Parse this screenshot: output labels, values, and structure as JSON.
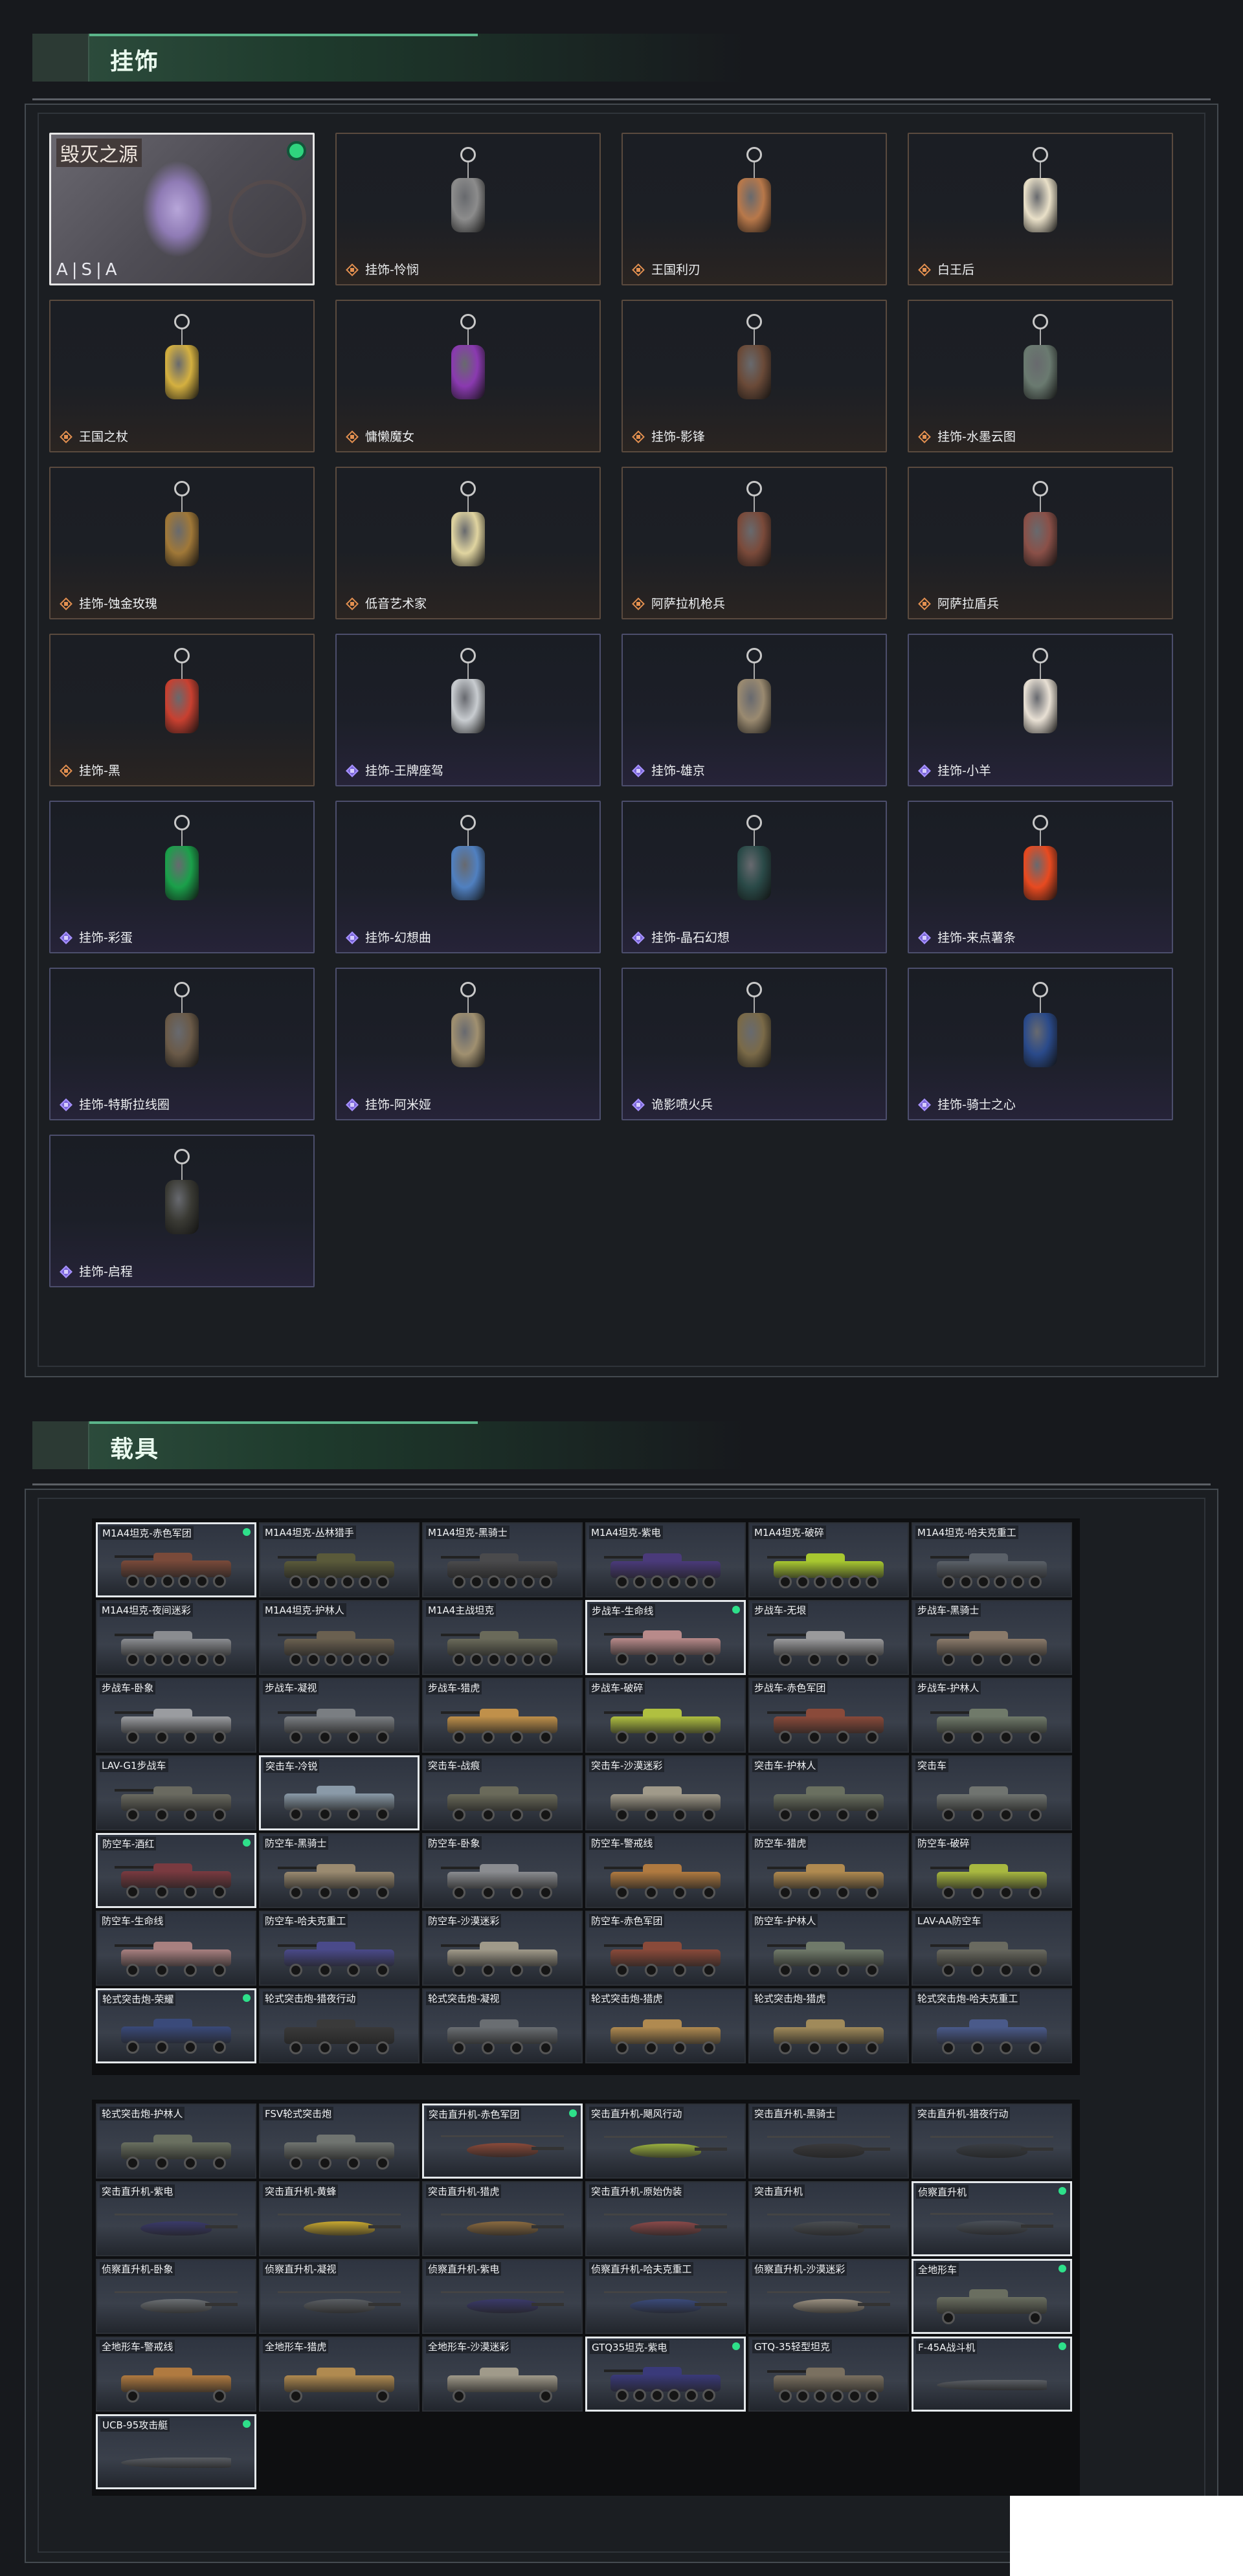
{
  "pendants": {
    "title": "挂饰",
    "featured": {
      "title": "毁灭之源",
      "logo": "A|S|A"
    },
    "items": [
      {
        "label": "挂饰-怜悯",
        "rarity": "orange",
        "color": "#8c8c8c"
      },
      {
        "label": "王国利刃",
        "rarity": "orange",
        "color": "#b8784a"
      },
      {
        "label": "白王后",
        "rarity": "orange",
        "color": "#e9e0c8"
      },
      {
        "label": "王国之杖",
        "rarity": "orange",
        "color": "#d4b040"
      },
      {
        "label": "慵懒魔女",
        "rarity": "orange",
        "color": "#8a3ab0"
      },
      {
        "label": "挂饰-影锋",
        "rarity": "orange",
        "color": "#6a4a38"
      },
      {
        "label": "挂饰-水墨云图",
        "rarity": "orange",
        "color": "#6a7a70"
      },
      {
        "label": "挂饰-蚀金玫瑰",
        "rarity": "orange",
        "color": "#a07838"
      },
      {
        "label": "低音艺术家",
        "rarity": "orange",
        "color": "#e0d4a0"
      },
      {
        "label": "阿萨拉机枪兵",
        "rarity": "orange",
        "color": "#7a4a3a"
      },
      {
        "label": "阿萨拉盾兵",
        "rarity": "orange",
        "color": "#8a5048"
      },
      {
        "label": "挂饰-黑",
        "rarity": "orange",
        "color": "#c84030"
      },
      {
        "label": "挂饰-王牌座驾",
        "rarity": "purple",
        "color": "#c8ccd0"
      },
      {
        "label": "挂饰-雄京",
        "rarity": "purple",
        "color": "#9a8a70"
      },
      {
        "label": "挂饰-小羊",
        "rarity": "purple",
        "color": "#e8e0d4"
      },
      {
        "label": "挂饰-彩蛋",
        "rarity": "purple",
        "color": "#1aa04a"
      },
      {
        "label": "挂饰-幻想曲",
        "rarity": "purple",
        "color": "#5080c0"
      },
      {
        "label": "挂饰-晶石幻想",
        "rarity": "purple",
        "color": "#2a4a48"
      },
      {
        "label": "挂饰-来点薯条",
        "rarity": "purple",
        "color": "#e84a20"
      },
      {
        "label": "挂饰-特斯拉线圈",
        "rarity": "purple",
        "color": "#6a5a48"
      },
      {
        "label": "挂饰-阿米娅",
        "rarity": "purple",
        "color": "#a09070"
      },
      {
        "label": "诡影喷火兵",
        "rarity": "purple",
        "color": "#7a6a48"
      },
      {
        "label": "挂饰-骑士之心",
        "rarity": "purple",
        "color": "#2a4a8a"
      },
      {
        "label": "挂饰-启程",
        "rarity": "purple",
        "color": "#3a3a34"
      }
    ]
  },
  "vehicles": {
    "title": "载具",
    "group1": [
      {
        "label": "M1A4坦克-赤色军团",
        "owned": true,
        "selected": true,
        "type": "tank",
        "color": "#7a4a3a"
      },
      {
        "label": "M1A4坦克-丛林猎手",
        "owned": false,
        "selected": false,
        "type": "tank",
        "color": "#5a5a3a"
      },
      {
        "label": "M1A4坦克-黑骑士",
        "owned": false,
        "selected": false,
        "type": "tank",
        "color": "#4a4a4c"
      },
      {
        "label": "M1A4坦克-紫电",
        "owned": false,
        "selected": false,
        "type": "tank",
        "color": "#4a3a7a"
      },
      {
        "label": "M1A4坦克-破碎",
        "owned": false,
        "selected": false,
        "type": "tank",
        "color": "#a8c830"
      },
      {
        "label": "M1A4坦克-哈夫克重工",
        "owned": false,
        "selected": false,
        "type": "tank",
        "color": "#5a6068"
      },
      {
        "label": "M1A4坦克-夜间迷彩",
        "owned": false,
        "selected": false,
        "type": "tank",
        "color": "#8a8c90"
      },
      {
        "label": "M1A4坦克-护林人",
        "owned": false,
        "selected": false,
        "type": "tank",
        "color": "#6a6050"
      },
      {
        "label": "M1A4主战坦克",
        "owned": false,
        "selected": false,
        "type": "tank",
        "color": "#6a6a5a"
      },
      {
        "label": "步战车-生命线",
        "owned": true,
        "selected": true,
        "type": "ifv",
        "color": "#b88a8a"
      },
      {
        "label": "步战车-无垠",
        "owned": false,
        "selected": false,
        "type": "ifv",
        "color": "#9a9a9c"
      },
      {
        "label": "步战车-黑骑士",
        "owned": false,
        "selected": false,
        "type": "ifv",
        "color": "#8a7a6a"
      },
      {
        "label": "步战车-卧象",
        "owned": false,
        "selected": false,
        "type": "ifv",
        "color": "#9a9ca0"
      },
      {
        "label": "步战车-凝视",
        "owned": false,
        "selected": false,
        "type": "ifv",
        "color": "#7a7e82"
      },
      {
        "label": "步战车-猎虎",
        "owned": false,
        "selected": false,
        "type": "ifv",
        "color": "#c0904a"
      },
      {
        "label": "步战车-破碎",
        "owned": false,
        "selected": false,
        "type": "ifv",
        "color": "#b0c040"
      },
      {
        "label": "步战车-赤色军团",
        "owned": false,
        "selected": false,
        "type": "ifv",
        "color": "#8a4a3a"
      },
      {
        "label": "步战车-护林人",
        "owned": false,
        "selected": false,
        "type": "ifv",
        "color": "#707a6a"
      },
      {
        "label": "LAV-G1步战车",
        "owned": false,
        "selected": false,
        "type": "ifv",
        "color": "#6a6a60"
      },
      {
        "label": "突击车-冷锐",
        "owned": false,
        "selected": true,
        "type": "truck",
        "color": "#8a9aa8"
      },
      {
        "label": "突击车-战痕",
        "owned": false,
        "selected": false,
        "type": "truck",
        "color": "#6a6a5a"
      },
      {
        "label": "突击车-沙漠迷彩",
        "owned": false,
        "selected": false,
        "type": "truck",
        "color": "#a09a8a"
      },
      {
        "label": "突击车-护林人",
        "owned": false,
        "selected": false,
        "type": "truck",
        "color": "#6a7060"
      },
      {
        "label": "突击车",
        "owned": false,
        "selected": false,
        "type": "truck",
        "color": "#707470"
      },
      {
        "label": "防空车-酒红",
        "owned": true,
        "selected": true,
        "type": "ifv",
        "color": "#7a3a40"
      },
      {
        "label": "防空车-黑骑士",
        "owned": false,
        "selected": false,
        "type": "ifv",
        "color": "#9a8a70"
      },
      {
        "label": "防空车-卧象",
        "owned": false,
        "selected": false,
        "type": "ifv",
        "color": "#8a8c90"
      },
      {
        "label": "防空车-警戒线",
        "owned": false,
        "selected": false,
        "type": "ifv",
        "color": "#b07a40"
      },
      {
        "label": "防空车-猎虎",
        "owned": false,
        "selected": false,
        "type": "ifv",
        "color": "#b08a50"
      },
      {
        "label": "防空车-破碎",
        "owned": false,
        "selected": false,
        "type": "ifv",
        "color": "#a8b840"
      },
      {
        "label": "防空车-生命线",
        "owned": false,
        "selected": false,
        "type": "ifv",
        "color": "#a88080"
      },
      {
        "label": "防空车-哈夫克重工",
        "owned": false,
        "selected": false,
        "type": "ifv",
        "color": "#4a4a8a"
      },
      {
        "label": "防空车-沙漠迷彩",
        "owned": false,
        "selected": false,
        "type": "ifv",
        "color": "#a09a8a"
      },
      {
        "label": "防空车-赤色军团",
        "owned": false,
        "selected": false,
        "type": "ifv",
        "color": "#8a4a3a"
      },
      {
        "label": "防空车-护林人",
        "owned": false,
        "selected": false,
        "type": "ifv",
        "color": "#707a6a"
      },
      {
        "label": "LAV-AA防空车",
        "owned": false,
        "selected": false,
        "type": "ifv",
        "color": "#6a6a60"
      },
      {
        "label": "轮式突击炮-荣耀",
        "owned": true,
        "selected": true,
        "type": "truck",
        "color": "#3a4a7a"
      },
      {
        "label": "轮式突击炮-猎夜行动",
        "owned": false,
        "selected": false,
        "type": "truck",
        "color": "#3a3a3a"
      },
      {
        "label": "轮式突击炮-凝视",
        "owned": false,
        "selected": false,
        "type": "truck",
        "color": "#6a6e72"
      },
      {
        "label": "轮式突击炮-猎虎",
        "owned": false,
        "selected": false,
        "type": "truck",
        "color": "#b08a50"
      },
      {
        "label": "轮式突击炮-猎虎",
        "owned": false,
        "selected": false,
        "type": "truck",
        "color": "#a08a5a"
      },
      {
        "label": "轮式突击炮-哈夫克重工",
        "owned": false,
        "selected": false,
        "type": "truck",
        "color": "#4a5a8a"
      }
    ],
    "group2": [
      {
        "label": "轮式突击炮-护林人",
        "owned": false,
        "selected": false,
        "type": "truck",
        "color": "#6a7060"
      },
      {
        "label": "FSV轮式突击炮",
        "owned": false,
        "selected": false,
        "type": "truck",
        "color": "#707470"
      },
      {
        "label": "突击直升机-赤色军团",
        "owned": true,
        "selected": true,
        "type": "heli",
        "color": "#8a4a3a"
      },
      {
        "label": "突击直升机-飓风行动",
        "owned": false,
        "selected": false,
        "type": "heli",
        "color": "#9ab040"
      },
      {
        "label": "突击直升机-黑骑士",
        "owned": false,
        "selected": false,
        "type": "heli",
        "color": "#3a3a3c"
      },
      {
        "label": "突击直升机-猎夜行动",
        "owned": false,
        "selected": false,
        "type": "heli",
        "color": "#3a3e44"
      },
      {
        "label": "突击直升机-紫电",
        "owned": false,
        "selected": false,
        "type": "heli",
        "color": "#3a3a6a"
      },
      {
        "label": "突击直升机-黄蜂",
        "owned": false,
        "selected": false,
        "type": "heli",
        "color": "#c8a830"
      },
      {
        "label": "突击直升机-猎虎",
        "owned": false,
        "selected": false,
        "type": "heli",
        "color": "#8a6a40"
      },
      {
        "label": "突击直升机-原始伪装",
        "owned": false,
        "selected": false,
        "type": "heli",
        "color": "#8a4a4a"
      },
      {
        "label": "突击直升机",
        "owned": false,
        "selected": false,
        "type": "heli",
        "color": "#4a4e52"
      },
      {
        "label": "侦察直升机",
        "owned": true,
        "selected": true,
        "type": "heli",
        "color": "#4a5058"
      },
      {
        "label": "侦察直升机-卧象",
        "owned": false,
        "selected": false,
        "type": "heli",
        "color": "#6a6e72"
      },
      {
        "label": "侦察直升机-凝视",
        "owned": false,
        "selected": false,
        "type": "heli",
        "color": "#5a5e62"
      },
      {
        "label": "侦察直升机-紫电",
        "owned": false,
        "selected": false,
        "type": "heli",
        "color": "#3a3a6a"
      },
      {
        "label": "侦察直升机-哈夫克重工",
        "owned": false,
        "selected": false,
        "type": "heli",
        "color": "#3a4a7a"
      },
      {
        "label": "侦察直升机-沙漠迷彩",
        "owned": false,
        "selected": false,
        "type": "heli",
        "color": "#9a9080"
      },
      {
        "label": "全地形车",
        "owned": true,
        "selected": true,
        "type": "atv",
        "color": "#6a6e60"
      },
      {
        "label": "全地形车-警戒线",
        "owned": false,
        "selected": false,
        "type": "atv",
        "color": "#b07a40"
      },
      {
        "label": "全地形车-猎虎",
        "owned": false,
        "selected": false,
        "type": "atv",
        "color": "#b08a50"
      },
      {
        "label": "全地形车-沙漠迷彩",
        "owned": false,
        "selected": false,
        "type": "atv",
        "color": "#a09a8a"
      },
      {
        "label": "GTQ35坦克-紫电",
        "owned": true,
        "selected": true,
        "type": "tank",
        "color": "#3a3a7a"
      },
      {
        "label": "GTQ-35轻型坦克",
        "owned": false,
        "selected": false,
        "type": "tank",
        "color": "#7a7060"
      },
      {
        "label": "F-45A战斗机",
        "owned": true,
        "selected": true,
        "type": "jet",
        "color": "#5a5e64"
      },
      {
        "label": "UCB-95攻击艇",
        "owned": true,
        "selected": true,
        "type": "boat",
        "color": "#5a5e64"
      }
    ]
  }
}
